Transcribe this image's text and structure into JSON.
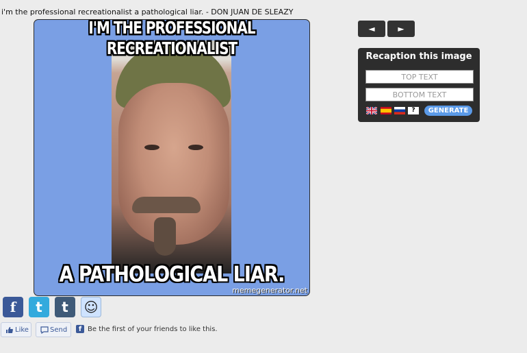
{
  "caption": "i'm the professional recreationalist a pathological liar. - DON JUAN DE SLEAZY",
  "meme": {
    "top_text": "I'M THE PROFESSIONAL RECREATIONALIST",
    "bottom_text": "A PATHOLOGICAL LIAR.",
    "watermark": "memegenerator.net"
  },
  "nav": {
    "prev_symbol": "◄",
    "next_symbol": "►"
  },
  "panel": {
    "title": "Recaption this image",
    "top_placeholder": "TOP TEXT",
    "bottom_placeholder": "BOTTOM TEXT",
    "help_symbol": "?",
    "generate_label": "GENERATE",
    "languages": [
      "uk-flag-icon",
      "spain-flag-icon",
      "russia-flag-icon",
      "help-icon"
    ]
  },
  "share": {
    "icons": [
      "facebook-icon",
      "twitter-icon",
      "tumblr-icon",
      "reddit-icon"
    ],
    "facebook_glyph": "f",
    "twitter_glyph": "t",
    "tumblr_glyph": "t",
    "reddit_glyph": "☺"
  },
  "facebook": {
    "like_label": "Like",
    "send_label": "Send",
    "social_text": "Be the first of your friends to like this.",
    "brand_color": "#3b5998"
  },
  "colors": {
    "meme_background": "#7a9fe4",
    "panel_background": "#2d2d2d",
    "generate_button": "#5b9ae8"
  }
}
